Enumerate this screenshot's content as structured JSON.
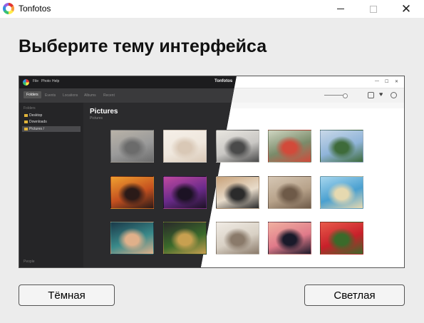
{
  "window": {
    "title": "Tonfotos",
    "icon": "tonfotos-logo-icon",
    "controls": [
      "minimize-icon",
      "maximize-icon",
      "close-icon"
    ]
  },
  "heading": "Выберите тему интерфейса",
  "preview": {
    "menu": [
      "File",
      "Photo",
      "Help"
    ],
    "app_title": "Tonfotos",
    "tabs": [
      "Folders",
      "Events",
      "Locations",
      "Albums",
      "Recent"
    ],
    "active_tab": "Folders",
    "sidebar_header": "Folders",
    "sidebar_items": [
      "Desktop",
      "Downloads",
      "Pictures /"
    ],
    "selected_item": "Pictures /",
    "sidebar_footer": "People",
    "folder_title": "Pictures",
    "folder_subtitle": "Pictures",
    "toolbar_icons": [
      "zoom-slider-icon",
      "info-icon",
      "heart-icon",
      "play-icon"
    ],
    "thumbnails": [
      {
        "name": "yoga-on-rocks-photo",
        "colors": [
          "#9a9a9a",
          "#6b6b6b",
          "#b9b3a8"
        ]
      },
      {
        "name": "wedding-couple-photo",
        "colors": [
          "#efe7dd",
          "#d9c8b6",
          "#f5efe8"
        ]
      },
      {
        "name": "laptop-work-photo",
        "colors": [
          "#c9c7c4",
          "#4a4a4a",
          "#e8e6e0"
        ]
      },
      {
        "name": "couple-portrait-photo",
        "colors": [
          "#7a8b6a",
          "#d24a3a",
          "#cfd6c2"
        ]
      },
      {
        "name": "mountain-lake-photo",
        "colors": [
          "#8fb4d9",
          "#3e6b3a",
          "#c8d8e8"
        ]
      },
      {
        "name": "concert-lights-photo",
        "colors": [
          "#c4501f",
          "#2a1a18",
          "#f0a030"
        ]
      },
      {
        "name": "purple-flowers-photo",
        "colors": [
          "#6a2a8a",
          "#1c1224",
          "#c04aa0"
        ]
      },
      {
        "name": "photographer-photo",
        "colors": [
          "#e8dccb",
          "#2b2b2b",
          "#c8a27a"
        ]
      },
      {
        "name": "old-town-photo",
        "colors": [
          "#b7a28a",
          "#6e5a48",
          "#d6c7b4"
        ]
      },
      {
        "name": "beach-sea-photo",
        "colors": [
          "#4aa0d0",
          "#e6d9b0",
          "#a6d6ee"
        ]
      },
      {
        "name": "sunglasses-man-photo",
        "colors": [
          "#3a8a8a",
          "#e0b08a",
          "#1a3a4a"
        ]
      },
      {
        "name": "pencils-circle-photo",
        "colors": [
          "#3a6a2a",
          "#c8a050",
          "#2a2a2a"
        ]
      },
      {
        "name": "corridor-columns-photo",
        "colors": [
          "#d8d0c4",
          "#8a7a6a",
          "#f0ebe4"
        ]
      },
      {
        "name": "jumping-silhouettes-photo",
        "colors": [
          "#e07a8a",
          "#1a1a2a",
          "#f0b0a0"
        ]
      },
      {
        "name": "apples-basket-photo",
        "colors": [
          "#c8202a",
          "#3a6a2a",
          "#e85a4a"
        ]
      }
    ]
  },
  "buttons": {
    "dark": "Тёмная",
    "light": "Светлая"
  }
}
